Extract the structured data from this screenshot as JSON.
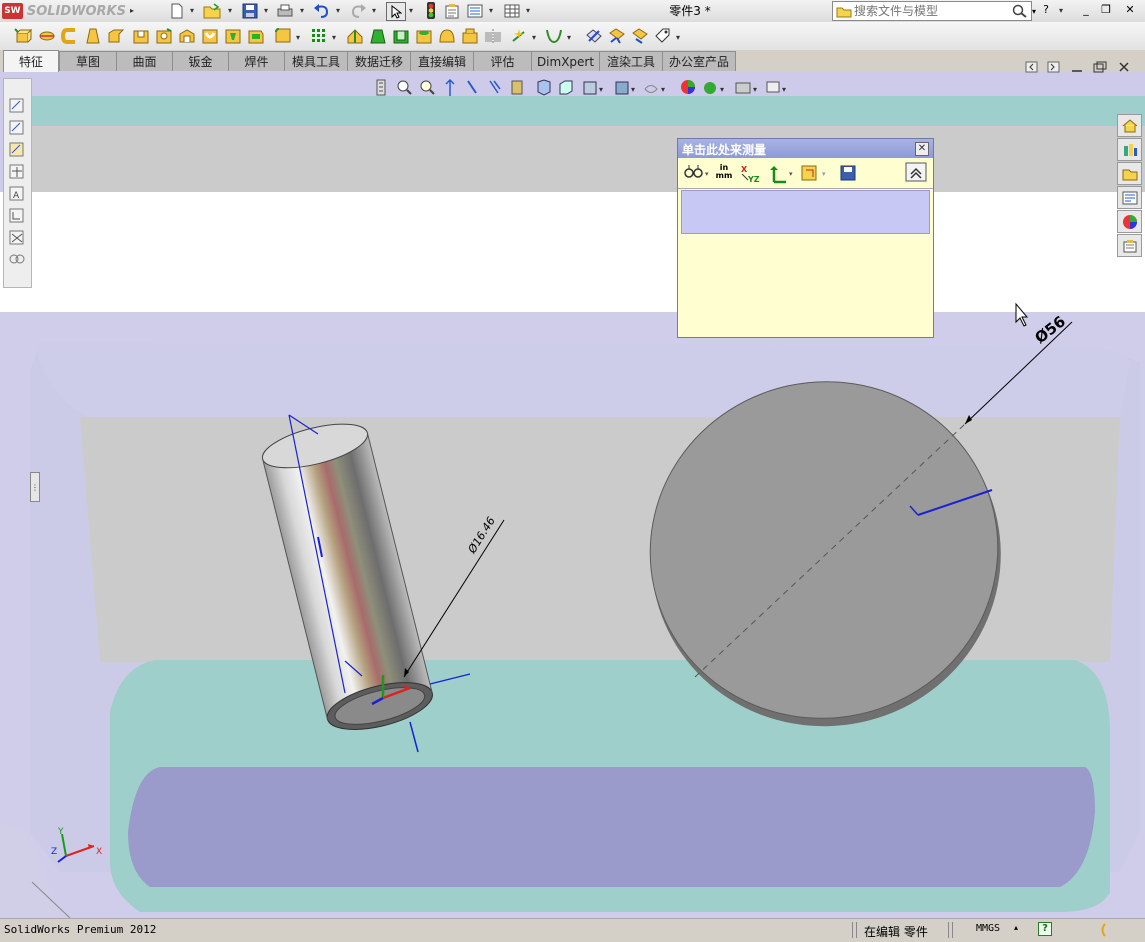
{
  "app": {
    "brand": "SOLIDWORKS",
    "brand_badge": "SW",
    "document_title": "零件3 *"
  },
  "search": {
    "placeholder": "搜索文件与模型"
  },
  "window_controls": {
    "help": "?",
    "minimize": "_",
    "restore": "❐",
    "close": "✕"
  },
  "tabs": [
    {
      "label": "特征",
      "active": true
    },
    {
      "label": "草图"
    },
    {
      "label": "曲面"
    },
    {
      "label": "钣金"
    },
    {
      "label": "焊件"
    },
    {
      "label": "模具工具"
    },
    {
      "label": "数据迁移"
    },
    {
      "label": "直接编辑"
    },
    {
      "label": "评估"
    },
    {
      "label": "DimXpert"
    },
    {
      "label": "渲染工具"
    },
    {
      "label": "办公室产品"
    }
  ],
  "measure_dialog": {
    "title": "单击此处来测量",
    "units_label_top": "in",
    "units_label_bottom": "mm",
    "xyz_label_x": "X",
    "xyz_label_yz": "YZ",
    "collapse_icon": "⌃",
    "close_icon": "✕"
  },
  "annotations": {
    "large_disk_dimension": "Ø56",
    "cylinder_dimension": "Ø16.46"
  },
  "triad": {
    "x": "X",
    "y": "Y",
    "z": "Z"
  },
  "statusbar": {
    "product": "SolidWorks Premium 2012",
    "mode": "在编辑 零件",
    "units": "MMGS",
    "help_icon": "?"
  },
  "colors": {
    "viewport_lavender": "#cfcde8",
    "floor_gray": "#cbcbcb",
    "teal_band": "#9ed0cc",
    "dimension_blue": "#1b22d4",
    "dialog_yellow": "#fffed0",
    "dialog_header": "#8d9ad6"
  },
  "icons": {
    "left_toolbar": [
      "dimension-icon",
      "annotation-icon",
      "sketch-icon",
      "relations-icon",
      "display-icon",
      "repair-icon",
      "smart-icon",
      "link-icon"
    ],
    "right_taskpane": [
      "home-icon",
      "resources-icon",
      "library-icon",
      "explorer-icon",
      "appearance-icon",
      "custom-properties-icon"
    ]
  }
}
